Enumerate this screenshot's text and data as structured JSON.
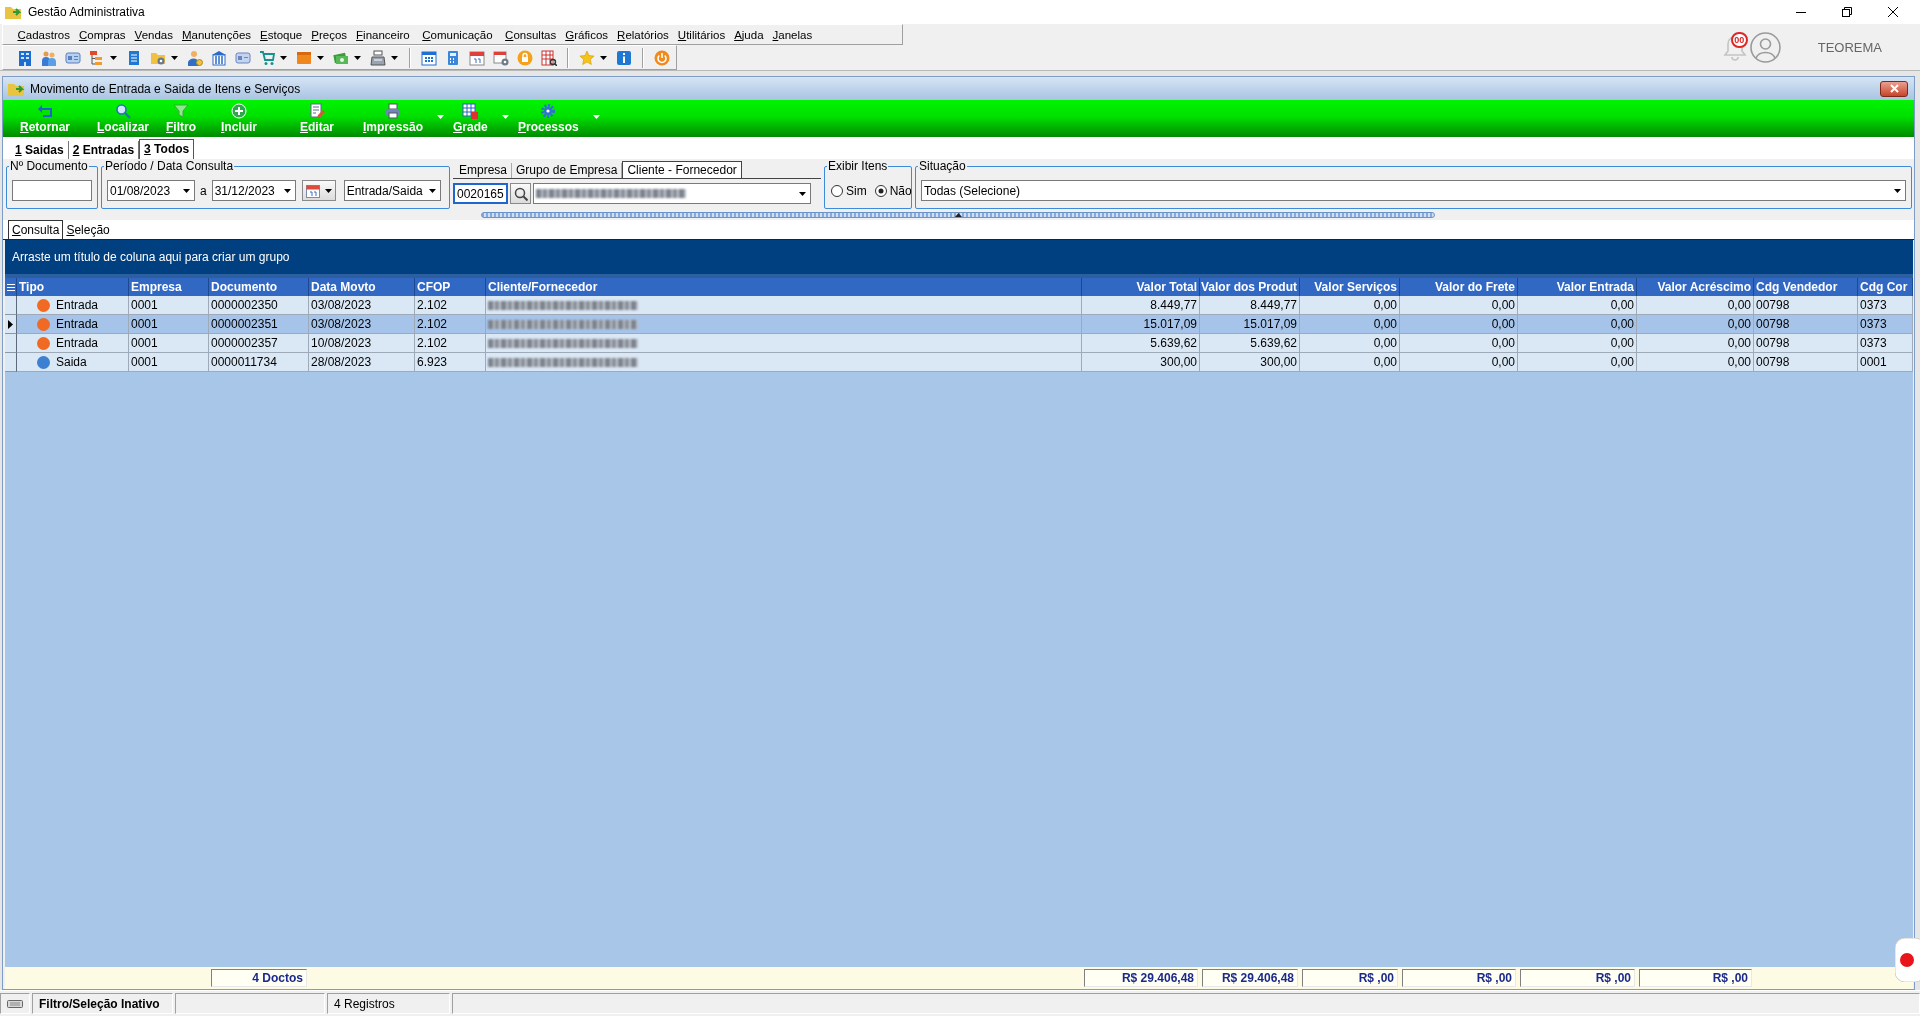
{
  "window": {
    "title": "Gestão Administrativa"
  },
  "menu": [
    "Cadastros",
    "Compras",
    "Vendas",
    "Manutenções",
    "Estoque",
    "Preços",
    "Financeiro",
    "Comunicação",
    "Consultas",
    "Gráficos",
    "Relatórios",
    "Utilitários",
    "Ajuda",
    "Janelas"
  ],
  "header_right": {
    "notification_count": "00",
    "user": "TEOREMA"
  },
  "child_window": {
    "title": "Movimento de Entrada e Saida de Itens e Serviços"
  },
  "actions": [
    {
      "label": "Retornar",
      "dropdown": false
    },
    {
      "label": "Localizar",
      "dropdown": false
    },
    {
      "label": "Filtro",
      "dropdown": false
    },
    {
      "label": "Incluir",
      "dropdown": false
    },
    {
      "label": "Editar",
      "dropdown": false
    },
    {
      "label": "Impressão",
      "dropdown": true
    },
    {
      "label": "Grade",
      "dropdown": true
    },
    {
      "label": "Processos",
      "dropdown": true
    }
  ],
  "mode_tabs": [
    {
      "label": "1 Saidas",
      "selected": false
    },
    {
      "label": "2 Entradas",
      "selected": false
    },
    {
      "label": "3 Todos",
      "selected": true
    }
  ],
  "filters": {
    "document": {
      "legend": "Nº Documento"
    },
    "period": {
      "legend": "Período / Data Consulta",
      "date_from": "01/08/2023",
      "separator": "a",
      "date_to": "31/12/2023",
      "movement": "Entrada/Saida"
    },
    "party": {
      "tabs": [
        {
          "label": "Empresa",
          "selected": false
        },
        {
          "label": "Grupo de Empresa",
          "selected": false
        },
        {
          "label": "Cliente - Fornecedor",
          "selected": true
        }
      ],
      "code": "0020165"
    },
    "show_items": {
      "legend": "Exibir Itens",
      "options": [
        {
          "label": "Sim",
          "selected": false
        },
        {
          "label": "Não",
          "selected": true
        }
      ]
    },
    "situation": {
      "legend": "Situação",
      "value": "Todas (Selecione)"
    }
  },
  "view_tabs": [
    {
      "label": "Consulta",
      "selected": true
    },
    {
      "label": "Seleção",
      "selected": false
    }
  ],
  "grid": {
    "group_hint": "Arraste um título de coluna aqui para criar um grupo",
    "columns": [
      {
        "label": "Tipo",
        "kind": "type"
      },
      {
        "label": "Empresa",
        "kind": "text"
      },
      {
        "label": "Documento",
        "kind": "text"
      },
      {
        "label": "Data Movto",
        "kind": "text"
      },
      {
        "label": "CFOP",
        "kind": "text"
      },
      {
        "label": "Cliente/Fornecedor",
        "kind": "redacted"
      },
      {
        "label": "Valor Total",
        "kind": "number"
      },
      {
        "label": "Valor dos Produt",
        "kind": "number"
      },
      {
        "label": "Valor Serviços",
        "kind": "number"
      },
      {
        "label": "Valor do Frete",
        "kind": "number"
      },
      {
        "label": "Valor Entrada",
        "kind": "number"
      },
      {
        "label": "Valor Acréscimo",
        "kind": "number"
      },
      {
        "label": "Cdg Vendedor",
        "kind": "text"
      },
      {
        "label": "Cdg Cor",
        "kind": "text"
      }
    ],
    "rows": [
      {
        "selected": false,
        "color": "#f06a23",
        "cells": [
          "Entrada",
          "0001",
          "0000002350",
          "03/08/2023",
          "2.102",
          null,
          "8.449,77",
          "8.449,77",
          "0,00",
          "0,00",
          "0,00",
          "0,00",
          "00798",
          "0373"
        ]
      },
      {
        "selected": true,
        "color": "#f06a23",
        "cells": [
          "Entrada",
          "0001",
          "0000002351",
          "03/08/2023",
          "2.102",
          null,
          "15.017,09",
          "15.017,09",
          "0,00",
          "0,00",
          "0,00",
          "0,00",
          "00798",
          "0373"
        ]
      },
      {
        "selected": false,
        "color": "#f06a23",
        "cells": [
          "Entrada",
          "0001",
          "0000002357",
          "10/08/2023",
          "2.102",
          null,
          "5.639,62",
          "5.639,62",
          "0,00",
          "0,00",
          "0,00",
          "0,00",
          "00798",
          "0373"
        ]
      },
      {
        "selected": false,
        "color": "#3d7fd0",
        "cells": [
          "Saida",
          "0001",
          "0000011734",
          "28/08/2023",
          "6.923",
          null,
          "300,00",
          "300,00",
          "0,00",
          "0,00",
          "0,00",
          "0,00",
          "00798",
          "0001"
        ]
      }
    ],
    "footer": {
      "count": "4 Doctos",
      "sums": [
        "R$ 29.406,48",
        "R$ 29.406,48",
        "R$ ,00",
        "R$ ,00",
        "R$ ,00",
        "R$ ,00"
      ]
    }
  },
  "status_bar": [
    {
      "kind": "status",
      "text": "Filtro/Seleção Inativo"
    },
    {
      "kind": "count",
      "text": "4 Registros"
    }
  ]
}
